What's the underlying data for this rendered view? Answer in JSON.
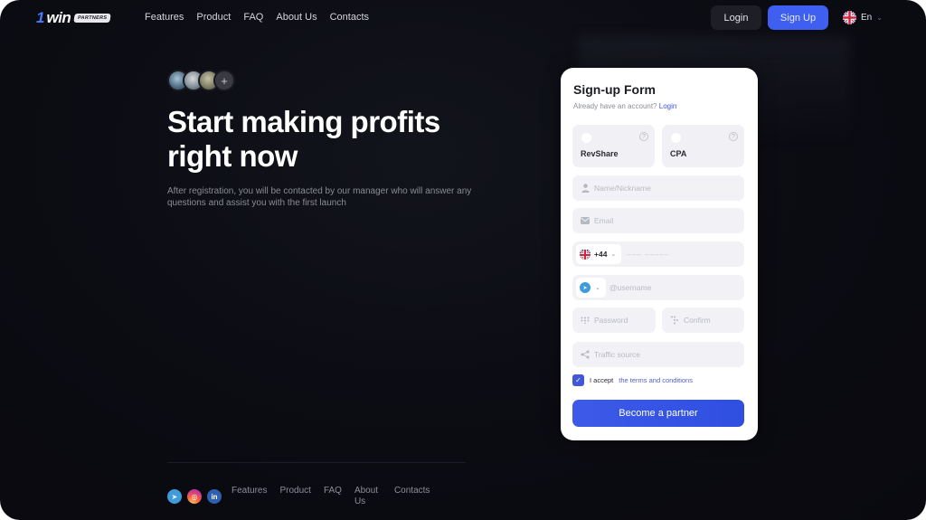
{
  "header": {
    "logo": {
      "mark": "1",
      "word": "win",
      "badge": "PARTNERS"
    },
    "nav": [
      "Features",
      "Product",
      "FAQ",
      "About Us",
      "Contacts"
    ],
    "login_label": "Login",
    "signup_label": "Sign Up",
    "language": {
      "label": "En",
      "flag_icon": "uk-flag-icon"
    }
  },
  "hero": {
    "avatar_more": "+",
    "title": "Start making profits right now",
    "subtitle": "After registration, you will be contacted by our manager who will answer any questions and assist you with the first launch"
  },
  "footer": {
    "socials": [
      {
        "name": "telegram",
        "glyph": "➤"
      },
      {
        "name": "instagram",
        "glyph": "◎"
      },
      {
        "name": "linkedin",
        "glyph": "in"
      }
    ],
    "nav": [
      "Features",
      "Product",
      "FAQ",
      "About Us",
      "Contacts"
    ]
  },
  "form": {
    "title": "Sign-up Form",
    "have_account": "Already have an account?",
    "login_link": "Login",
    "plans": [
      {
        "label": "RevShare",
        "help": "?"
      },
      {
        "label": "CPA",
        "help": "?"
      }
    ],
    "name_placeholder": "Name/Nickname",
    "email_placeholder": "Email",
    "phone": {
      "country_code": "+44",
      "mask": "––– –––––"
    },
    "messenger": {
      "placeholder": "@username"
    },
    "password_placeholder": "Password",
    "confirm_placeholder": "Confirm",
    "traffic_placeholder": "Traffic source",
    "accept_text": "I accept",
    "terms_link": "the terms and conditions",
    "accept_checked": true,
    "submit_label": "Become a partner"
  },
  "colors": {
    "accent": "#3f5ff0",
    "background": "#0b0b12",
    "card": "#ffffff"
  }
}
